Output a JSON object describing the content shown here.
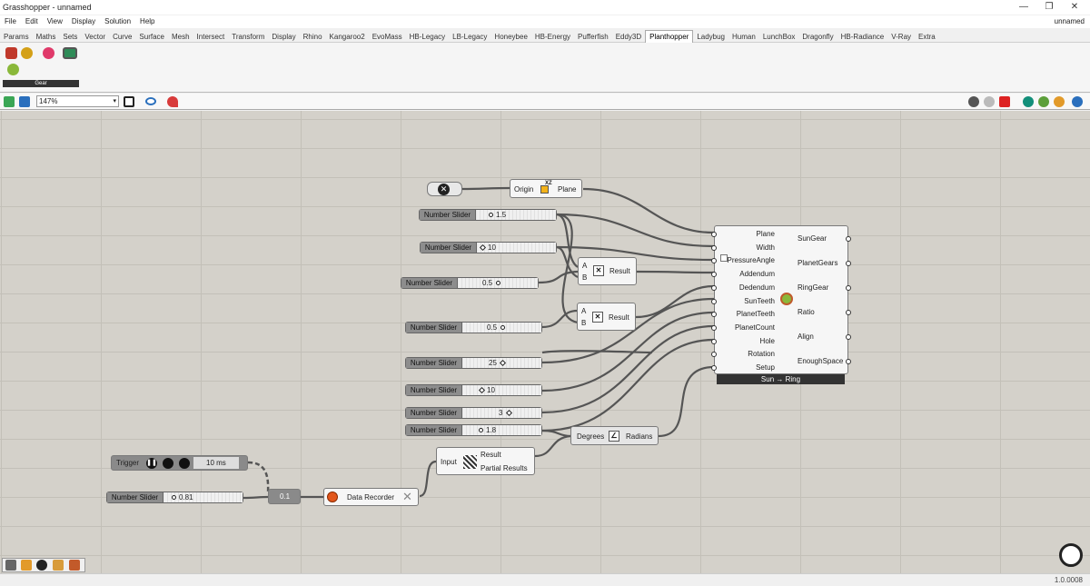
{
  "window": {
    "title": "Grasshopper - unnamed",
    "document_name": "unnamed",
    "min_glyph": "—",
    "max_glyph": "❐",
    "close_glyph": "✕"
  },
  "menu": [
    "File",
    "Edit",
    "View",
    "Display",
    "Solution",
    "Help"
  ],
  "tabs": [
    "Params",
    "Maths",
    "Sets",
    "Vector",
    "Curve",
    "Surface",
    "Mesh",
    "Intersect",
    "Transform",
    "Display",
    "Rhino",
    "Kangaroo2",
    "EvoMass",
    "HB-Legacy",
    "LB-Legacy",
    "Honeybee",
    "HB-Energy",
    "Pufferfish",
    "Eddy3D",
    "Planthopper",
    "Ladybug",
    "Human",
    "LunchBox",
    "Dragonfly",
    "HB-Radiance",
    "V-Ray",
    "Extra"
  ],
  "active_tab": "Planthopper",
  "ribbon": {
    "panel_caption": "Gear"
  },
  "toolbar": {
    "zoom": "147%"
  },
  "status": {
    "version": "1.0.0008"
  },
  "canvas": {
    "xy_plane_label": "XZ",
    "origin_plane": {
      "input": "Origin",
      "output": "Plane"
    },
    "multiply1": {
      "a": "A",
      "b": "B",
      "out": "Result"
    },
    "multiply2": {
      "a": "A",
      "b": "B",
      "out": "Result"
    },
    "sliders": [
      {
        "label": "Number Slider",
        "value": "1.5"
      },
      {
        "label": "Number Slider",
        "value": "10"
      },
      {
        "label": "Number Slider",
        "value": "0.5"
      },
      {
        "label": "Number Slider",
        "value": "0.5"
      },
      {
        "label": "Number Slider",
        "value": "25"
      },
      {
        "label": "Number Slider",
        "value": "10"
      },
      {
        "label": "Number Slider",
        "value": "3"
      },
      {
        "label": "Number Slider",
        "value": "1.8"
      },
      {
        "label": "Number Slider",
        "value": "0.81"
      }
    ],
    "gear": {
      "inputs": [
        "Plane",
        "Width",
        "PressureAngle",
        "Addendum",
        "Dedendum",
        "SunTeeth",
        "PlanetTeeth",
        "PlanetCount",
        "Hole",
        "Rotation",
        "Setup"
      ],
      "outputs": [
        "SunGear",
        "PlanetGears",
        "RingGear",
        "Ratio",
        "Align",
        "EnoughSpace"
      ],
      "footer": "Sun → Ring"
    },
    "radians": {
      "input": "Degrees",
      "output": "Radians"
    },
    "flatten": {
      "input": "Input",
      "out1": "Result",
      "out2": "Partial Results"
    },
    "trigger": {
      "label": "Trigger",
      "interval": "10 ms"
    },
    "data_recorder": {
      "label": "Data Recorder"
    },
    "panel_value": "0.1"
  }
}
